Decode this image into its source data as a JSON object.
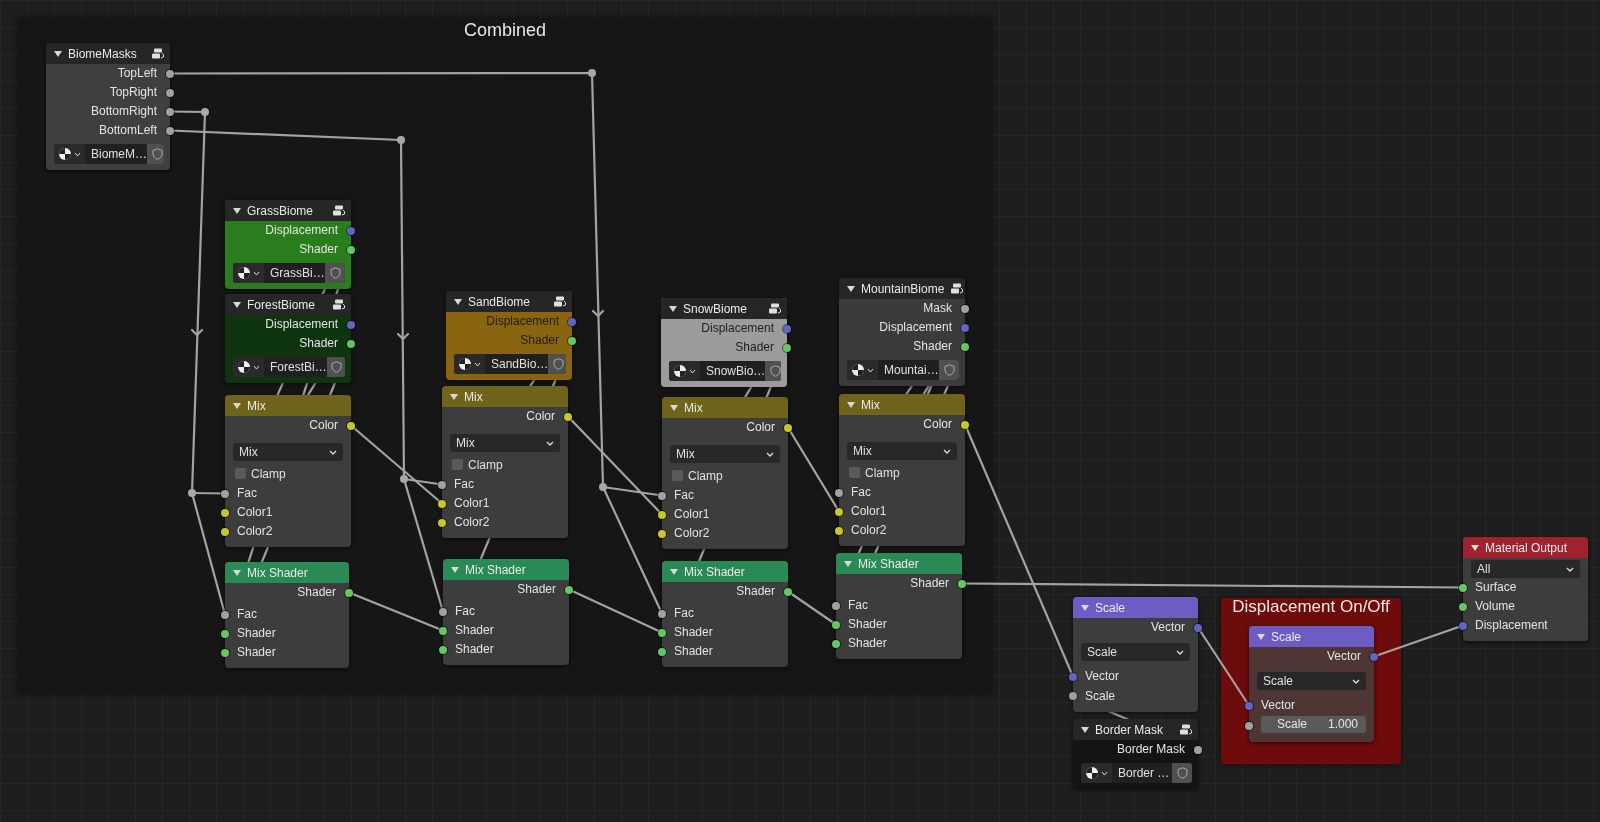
{
  "frames": [
    {
      "title": "Combined",
      "color": "#161616"
    },
    {
      "title": "Displacement On/Off",
      "color": "#6e0b0b"
    }
  ],
  "nodes": [
    {
      "kind": "group",
      "title": "BiomeMasks",
      "color": "#3f3f3f",
      "outputs": [
        {
          "label": "TopLeft",
          "color": "#a1a1a1"
        },
        {
          "label": "TopRight",
          "color": "#a1a1a1"
        },
        {
          "label": "BottomRight",
          "color": "#a1a1a1"
        },
        {
          "label": "BottomLeft",
          "color": "#a1a1a1"
        }
      ],
      "datablock": "BiomeM…"
    },
    {
      "kind": "group",
      "title": "GrassBiome",
      "color": "#2a7d1c",
      "outputs": [
        {
          "label": "Displacement",
          "color": "#6363c7"
        },
        {
          "label": "Shader",
          "color": "#63c763"
        }
      ],
      "datablock": "GrassBi…"
    },
    {
      "kind": "group",
      "title": "ForestBiome",
      "color": "#0e3510",
      "outputs": [
        {
          "label": "Displacement",
          "color": "#6363c7"
        },
        {
          "label": "Shader",
          "color": "#63c763"
        }
      ],
      "datablock": "ForestBi…"
    },
    {
      "kind": "mix",
      "title": "Mix",
      "outputs": [
        {
          "label": "Color",
          "color": "#c7c729"
        }
      ],
      "mode": "Mix",
      "clamp": {
        "label": "Clamp",
        "checked": false
      },
      "inputs": [
        {
          "label": "Fac",
          "color": "#a1a1a1"
        },
        {
          "label": "Color1",
          "color": "#c7c729"
        },
        {
          "label": "Color2",
          "color": "#c7c729"
        }
      ]
    },
    {
      "kind": "mix_shader",
      "title": "Mix Shader",
      "outputs": [
        {
          "label": "Shader",
          "color": "#63c763"
        }
      ],
      "inputs": [
        {
          "label": "Fac",
          "color": "#a1a1a1"
        },
        {
          "label": "Shader",
          "color": "#63c763"
        },
        {
          "label": "Shader",
          "color": "#63c763"
        }
      ]
    },
    {
      "kind": "group",
      "title": "SandBiome",
      "color": "#8a6510",
      "outputs": [
        {
          "label": "Displacement",
          "color": "#6363c7"
        },
        {
          "label": "Shader",
          "color": "#63c763"
        }
      ],
      "datablock": "SandBio…"
    },
    {
      "kind": "mix",
      "title": "Mix",
      "outputs": [
        {
          "label": "Color",
          "color": "#c7c729"
        }
      ],
      "mode": "Mix",
      "clamp": {
        "label": "Clamp",
        "checked": false
      },
      "inputs": [
        {
          "label": "Fac",
          "color": "#a1a1a1"
        },
        {
          "label": "Color1",
          "color": "#c7c729"
        },
        {
          "label": "Color2",
          "color": "#c7c729"
        }
      ]
    },
    {
      "kind": "mix_shader",
      "title": "Mix Shader",
      "outputs": [
        {
          "label": "Shader",
          "color": "#63c763"
        }
      ],
      "inputs": [
        {
          "label": "Fac",
          "color": "#a1a1a1"
        },
        {
          "label": "Shader",
          "color": "#63c763"
        },
        {
          "label": "Shader",
          "color": "#63c763"
        }
      ]
    },
    {
      "kind": "group",
      "title": "SnowBiome",
      "color": "#9c9c9c",
      "outputs": [
        {
          "label": "Displacement",
          "color": "#6363c7"
        },
        {
          "label": "Shader",
          "color": "#63c763"
        }
      ],
      "datablock": "SnowBio…"
    },
    {
      "kind": "mix",
      "title": "Mix",
      "outputs": [
        {
          "label": "Color",
          "color": "#c7c729"
        }
      ],
      "mode": "Mix",
      "clamp": {
        "label": "Clamp",
        "checked": false
      },
      "inputs": [
        {
          "label": "Fac",
          "color": "#a1a1a1"
        },
        {
          "label": "Color1",
          "color": "#c7c729"
        },
        {
          "label": "Color2",
          "color": "#c7c729"
        }
      ]
    },
    {
      "kind": "mix_shader",
      "title": "Mix Shader",
      "outputs": [
        {
          "label": "Shader",
          "color": "#63c763"
        }
      ],
      "inputs": [
        {
          "label": "Fac",
          "color": "#a1a1a1"
        },
        {
          "label": "Shader",
          "color": "#63c763"
        },
        {
          "label": "Shader",
          "color": "#63c763"
        }
      ]
    },
    {
      "kind": "group",
      "title": "MountainBiome",
      "color": "#3b3b3b",
      "outputs": [
        {
          "label": "Mask",
          "color": "#a1a1a1"
        },
        {
          "label": "Displacement",
          "color": "#6363c7"
        },
        {
          "label": "Shader",
          "color": "#63c763"
        }
      ],
      "datablock": "Mountai…"
    },
    {
      "kind": "mix",
      "title": "Mix",
      "outputs": [
        {
          "label": "Color",
          "color": "#c7c729"
        }
      ],
      "mode": "Mix",
      "clamp": {
        "label": "Clamp",
        "checked": false
      },
      "inputs": [
        {
          "label": "Fac",
          "color": "#a1a1a1"
        },
        {
          "label": "Color1",
          "color": "#c7c729"
        },
        {
          "label": "Color2",
          "color": "#c7c729"
        }
      ]
    },
    {
      "kind": "mix_shader",
      "title": "Mix Shader",
      "outputs": [
        {
          "label": "Shader",
          "color": "#63c763"
        }
      ],
      "inputs": [
        {
          "label": "Fac",
          "color": "#a1a1a1"
        },
        {
          "label": "Shader",
          "color": "#63c763"
        },
        {
          "label": "Shader",
          "color": "#63c763"
        }
      ]
    },
    {
      "kind": "vector_math",
      "title": "Scale",
      "outputs": [
        {
          "label": "Vector",
          "color": "#6363c7"
        }
      ],
      "operation": "Scale",
      "inputs": [
        {
          "label": "Vector",
          "color": "#6363c7"
        },
        {
          "label": "Scale",
          "color": "#a1a1a1"
        }
      ]
    },
    {
      "kind": "group",
      "title": "Border Mask",
      "color": "#141414",
      "outputs": [
        {
          "label": "Border Mask",
          "color": "#a1a1a1"
        }
      ],
      "datablock": "Border …"
    },
    {
      "kind": "vector_math",
      "title": "Scale",
      "outputs": [
        {
          "label": "Vector",
          "color": "#6363c7"
        }
      ],
      "operation": "Scale",
      "inputs": [
        {
          "label": "Vector",
          "color": "#6363c7"
        },
        {
          "label": "Scale",
          "color": "#a1a1a1",
          "value": "1.000"
        }
      ]
    },
    {
      "kind": "output",
      "title": "Material Output",
      "target": "All",
      "inputs": [
        {
          "label": "Surface",
          "color": "#63c763"
        },
        {
          "label": "Volume",
          "color": "#63c763"
        },
        {
          "label": "Displacement",
          "color": "#6363c7"
        }
      ]
    }
  ]
}
